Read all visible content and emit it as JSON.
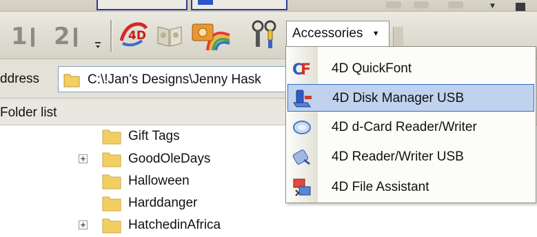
{
  "toolbar": {
    "buttons": [
      {
        "name": "one-button",
        "label": "1"
      },
      {
        "name": "two-button",
        "label": "2"
      }
    ],
    "app_icons": [
      "4d-logo-icon",
      "book-icon",
      "photo-rainbow-icon",
      "tools-icon"
    ],
    "dropdown_label": "Accessories"
  },
  "address": {
    "label": "ddress",
    "path": "C:\\!Jan's Designs\\Jenny Hask"
  },
  "folder_list": {
    "label": "Folder list",
    "items": [
      {
        "name": "Gift Tags",
        "expandable": false
      },
      {
        "name": "GoodOleDays",
        "expandable": true
      },
      {
        "name": "Halloween",
        "expandable": false
      },
      {
        "name": "Harddanger",
        "expandable": false
      },
      {
        "name": "HatchedinAfrica",
        "expandable": true
      }
    ]
  },
  "menu": {
    "items": [
      {
        "label": "4D QuickFont",
        "icon": "quickfont-icon",
        "highlighted": false
      },
      {
        "label": "4D Disk Manager USB",
        "icon": "disk-manager-icon",
        "highlighted": true
      },
      {
        "label": "4D d-Card Reader/Writer",
        "icon": "card-reader-icon",
        "highlighted": false
      },
      {
        "label": "4D Reader/Writer USB",
        "icon": "reader-writer-icon",
        "highlighted": false
      },
      {
        "label": "4D File Assistant",
        "icon": "file-assistant-icon",
        "highlighted": false
      }
    ]
  },
  "colors": {
    "menu_highlight": "#c1d2ee",
    "menu_highlight_border": "#316ac5",
    "toolbar_bg": "#e2dfd4",
    "folder_yellow": "#f3cf63"
  }
}
